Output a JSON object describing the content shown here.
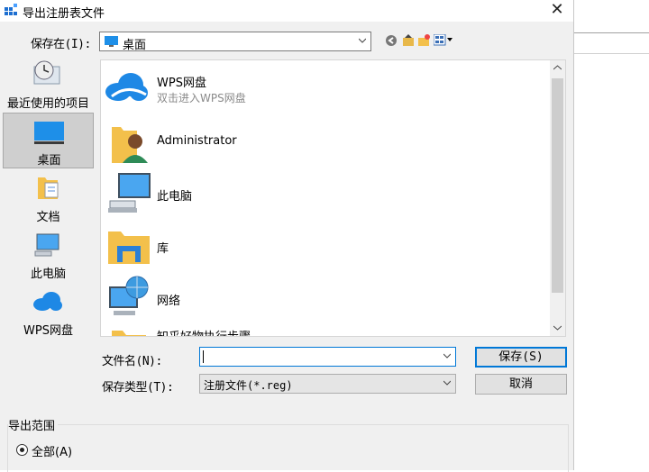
{
  "dialog": {
    "title": "导出注册表文件",
    "close_label": "✕"
  },
  "toolbar": {
    "save_in_label": "保存在(I):",
    "location_value": "桌面"
  },
  "places": [
    {
      "label": "最近使用的项目",
      "icon": "recent-icon",
      "selected": false
    },
    {
      "label": "桌面",
      "icon": "desktop-icon",
      "selected": true
    },
    {
      "label": "文档",
      "icon": "documents-icon",
      "selected": false
    },
    {
      "label": "此电脑",
      "icon": "computer-icon",
      "selected": false
    },
    {
      "label": "WPS网盘",
      "icon": "cloud-icon",
      "selected": false
    }
  ],
  "files": [
    {
      "name": "WPS网盘",
      "sub": "双击进入WPS网盘",
      "icon": "cloud-icon"
    },
    {
      "name": "Administrator",
      "icon": "user-folder-icon"
    },
    {
      "name": "此电脑",
      "icon": "computer-icon"
    },
    {
      "name": "库",
      "icon": "library-folder-icon"
    },
    {
      "name": "网络",
      "icon": "network-icon"
    },
    {
      "name": "知乎好物执行步骤",
      "icon": "folder-icon"
    }
  ],
  "filename": {
    "label": "文件名(N):",
    "value": ""
  },
  "filetype": {
    "label": "保存类型(T):",
    "value": "注册文件(*.reg)"
  },
  "buttons": {
    "save": "保存(S)",
    "cancel": "取消"
  },
  "export_range": {
    "label": "导出范围",
    "option_all": "全部(A)",
    "all_selected": true
  },
  "colors": {
    "accent": "#0078d7",
    "cloud": "#1e88e5",
    "folder": "#f3c04b"
  }
}
